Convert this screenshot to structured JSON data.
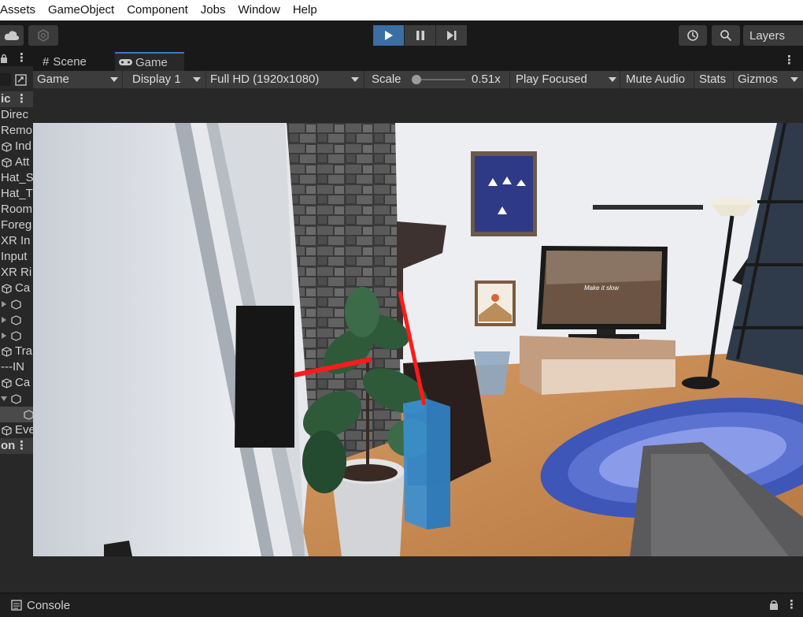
{
  "menu": [
    "Assets",
    "GameObject",
    "Component",
    "Jobs",
    "Window",
    "Help"
  ],
  "toolbar": {
    "layers_label": "Layers"
  },
  "hierarchy": {
    "items": [
      {
        "label": "ic",
        "type": "header"
      },
      {
        "label": "Direc",
        "type": "text"
      },
      {
        "label": "Remo",
        "type": "text"
      },
      {
        "label": "Ind",
        "type": "cube"
      },
      {
        "label": "Att",
        "type": "cube"
      },
      {
        "label": "Hat_S",
        "type": "text"
      },
      {
        "label": "Hat_T",
        "type": "text"
      },
      {
        "label": "Room",
        "type": "text"
      },
      {
        "label": "Foreg",
        "type": "text"
      },
      {
        "label": "XR In",
        "type": "text"
      },
      {
        "label": "Input",
        "type": "text"
      },
      {
        "label": "XR Ri",
        "type": "text"
      },
      {
        "label": "Ca",
        "type": "cube"
      },
      {
        "label": "",
        "type": "child"
      },
      {
        "label": "",
        "type": "child"
      },
      {
        "label": "",
        "type": "child"
      },
      {
        "label": "Tra",
        "type": "cube"
      },
      {
        "label": "---IN",
        "type": "text"
      },
      {
        "label": "Ca",
        "type": "cube"
      },
      {
        "label": "",
        "type": "expanded"
      },
      {
        "label": "",
        "type": "selected"
      },
      {
        "label": "Eve",
        "type": "cube"
      },
      {
        "label": "on",
        "type": "header"
      }
    ]
  },
  "tabs": {
    "scene": "Scene",
    "game": "Game"
  },
  "game_toolbar": {
    "view": "Game",
    "display": "Display 1",
    "resolution": "Full HD (1920x1080)",
    "scale_label": "Scale",
    "scale_value": "0.51x",
    "scale_fraction": 0.0,
    "play_mode": "Play Focused",
    "mute": "Mute Audio",
    "stats": "Stats",
    "gizmos": "Gizmos"
  },
  "scene": {
    "tv_caption": "Make it slow"
  },
  "console": {
    "label": "Console"
  },
  "colors": {
    "accent": "#3a6ea5",
    "ray": "#ff1a1a",
    "rug": "#4a63c8"
  }
}
